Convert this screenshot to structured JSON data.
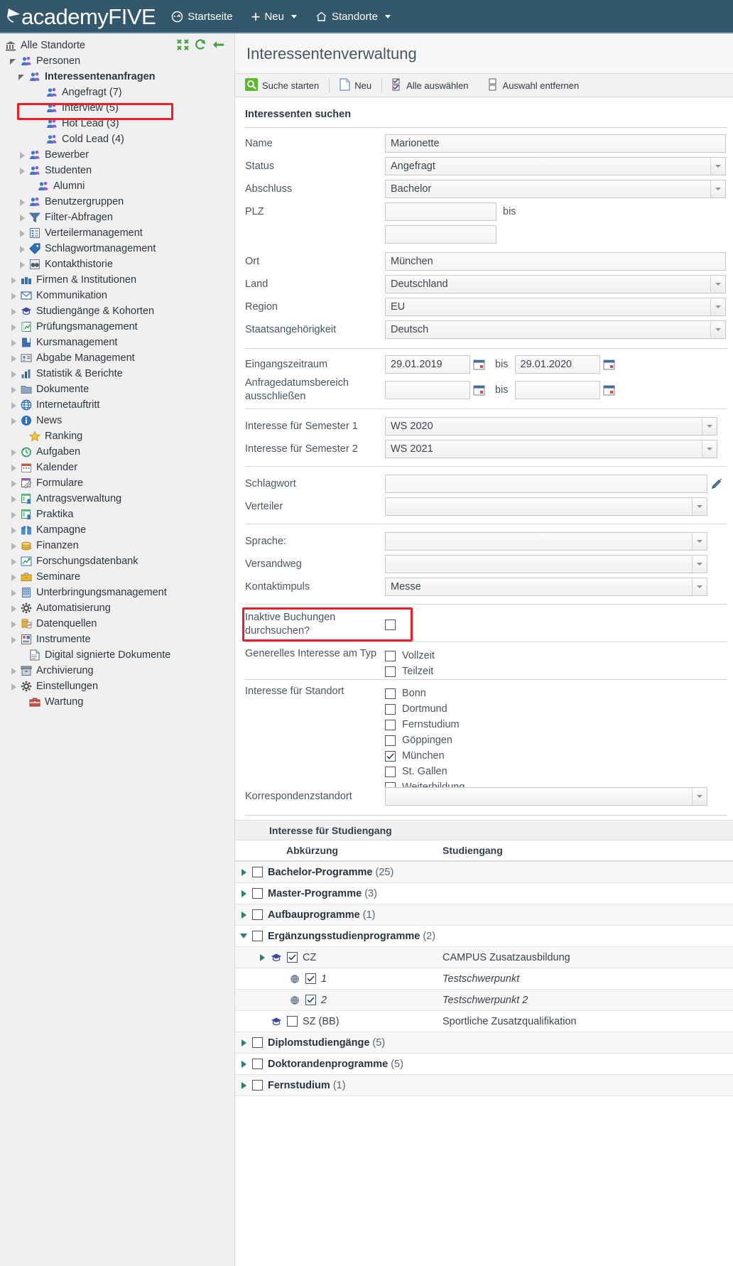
{
  "topbar": {
    "brand_a": "academy",
    "brand_b": "FIVE",
    "nav": [
      {
        "label": "Startseite",
        "icon": "dashboard-icon",
        "caret": false
      },
      {
        "label": "Neu",
        "icon": "plus-icon",
        "caret": true
      },
      {
        "label": "Standorte",
        "icon": "home-icon",
        "caret": true
      }
    ]
  },
  "sidebar": {
    "root": "Alle Standorte",
    "items": [
      {
        "label": "Personen",
        "indent": 1,
        "arrow": "open",
        "icon": "people-icon"
      },
      {
        "label": "Interessentenanfragen",
        "indent": 2,
        "arrow": "open",
        "icon": "people-icon",
        "bold": true,
        "highlight": true
      },
      {
        "label": "Angefragt (7)",
        "indent": 4,
        "arrow": "none",
        "icon": "people-icon"
      },
      {
        "label": "Interview (5)",
        "indent": 4,
        "arrow": "none",
        "icon": "people-icon"
      },
      {
        "label": "Hot Lead (3)",
        "indent": 4,
        "arrow": "none",
        "icon": "people-icon"
      },
      {
        "label": "Cold Lead (4)",
        "indent": 4,
        "arrow": "none",
        "icon": "people-icon"
      },
      {
        "label": "Bewerber",
        "indent": 2,
        "arrow": "closed",
        "icon": "people-icon"
      },
      {
        "label": "Studenten",
        "indent": 2,
        "arrow": "closed",
        "icon": "people-icon"
      },
      {
        "label": "Alumni",
        "indent": 3,
        "arrow": "none",
        "icon": "people-icon"
      },
      {
        "label": "Benutzergruppen",
        "indent": 2,
        "arrow": "closed",
        "icon": "people-icon"
      },
      {
        "label": "Filter-Abfragen",
        "indent": 2,
        "arrow": "closed",
        "icon": "filter-icon"
      },
      {
        "label": "Verteilermanagement",
        "indent": 2,
        "arrow": "closed",
        "icon": "list-icon"
      },
      {
        "label": "Schlagwortmanagement",
        "indent": 2,
        "arrow": "closed",
        "icon": "tag-icon"
      },
      {
        "label": "Kontakthistorie",
        "indent": 2,
        "arrow": "closed",
        "icon": "binoculars-icon"
      },
      {
        "label": "Firmen & Institutionen",
        "indent": 1,
        "arrow": "closed",
        "icon": "factory-icon"
      },
      {
        "label": "Kommunikation",
        "indent": 1,
        "arrow": "closed",
        "icon": "mail-icon"
      },
      {
        "label": "Studiengänge & Kohorten",
        "indent": 1,
        "arrow": "closed",
        "icon": "graduation-cap-icon"
      },
      {
        "label": "Prüfungsmanagement",
        "indent": 1,
        "arrow": "closed",
        "icon": "exam-icon"
      },
      {
        "label": "Kursmanagement",
        "indent": 1,
        "arrow": "closed",
        "icon": "book-icon"
      },
      {
        "label": "Abgabe Management",
        "indent": 1,
        "arrow": "closed",
        "icon": "card-icon"
      },
      {
        "label": "Statistik & Berichte",
        "indent": 1,
        "arrow": "closed",
        "icon": "bar-chart-icon"
      },
      {
        "label": "Dokumente",
        "indent": 1,
        "arrow": "closed",
        "icon": "folder-icon"
      },
      {
        "label": "Internetauftritt",
        "indent": 1,
        "arrow": "closed",
        "icon": "globe-icon"
      },
      {
        "label": "News",
        "indent": 1,
        "arrow": "closed",
        "icon": "info-icon"
      },
      {
        "label": "Ranking",
        "indent": 2,
        "arrow": "none",
        "icon": "star-icon"
      },
      {
        "label": "Aufgaben",
        "indent": 1,
        "arrow": "closed",
        "icon": "clock-icon"
      },
      {
        "label": "Kalender",
        "indent": 1,
        "arrow": "closed",
        "icon": "calendar-icon"
      },
      {
        "label": "Formulare",
        "indent": 1,
        "arrow": "closed",
        "icon": "form-icon"
      },
      {
        "label": "Antragsverwaltung",
        "indent": 1,
        "arrow": "closed",
        "icon": "application-icon"
      },
      {
        "label": "Praktika",
        "indent": 1,
        "arrow": "closed",
        "icon": "application-icon"
      },
      {
        "label": "Kampagne",
        "indent": 1,
        "arrow": "closed",
        "icon": "gift-icon"
      },
      {
        "label": "Finanzen",
        "indent": 1,
        "arrow": "closed",
        "icon": "coins-icon"
      },
      {
        "label": "Forschungsdatenbank",
        "indent": 1,
        "arrow": "closed",
        "icon": "research-icon"
      },
      {
        "label": "Seminare",
        "indent": 1,
        "arrow": "closed",
        "icon": "briefcase-icon"
      },
      {
        "label": "Unterbringungsmanagement",
        "indent": 1,
        "arrow": "closed",
        "icon": "building-icon"
      },
      {
        "label": "Automatisierung",
        "indent": 1,
        "arrow": "closed",
        "icon": "gear-icon"
      },
      {
        "label": "Datenquellen",
        "indent": 1,
        "arrow": "closed",
        "icon": "database-icon"
      },
      {
        "label": "Instrumente",
        "indent": 1,
        "arrow": "closed",
        "icon": "instruments-icon"
      },
      {
        "label": "Digital signierte Dokumente",
        "indent": 2,
        "arrow": "none",
        "icon": "document-icon"
      },
      {
        "label": "Archivierung",
        "indent": 1,
        "arrow": "closed",
        "icon": "archive-icon"
      },
      {
        "label": "Einstellungen",
        "indent": 1,
        "arrow": "closed",
        "icon": "gear-icon"
      },
      {
        "label": "Wartung",
        "indent": 2,
        "arrow": "none",
        "icon": "toolbox-icon"
      }
    ]
  },
  "page": {
    "title": "Interessentenverwaltung",
    "toolbar": [
      {
        "label": "Suche starten",
        "icon": "search-icon"
      },
      {
        "label": "Neu",
        "icon": "new-document-icon"
      },
      {
        "label": "Alle auswählen",
        "icon": "select-all-icon"
      },
      {
        "label": "Auswahl entfernen",
        "icon": "deselect-icon"
      }
    ],
    "section_title": "Interessenten suchen",
    "fields": {
      "name_label": "Name",
      "name_value": "Marionette",
      "status_label": "Status",
      "status_value": "Angefragt",
      "abschluss_label": "Abschluss",
      "abschluss_value": "Bachelor",
      "plz_label": "PLZ",
      "plz_from": "",
      "plz_to": "",
      "bis": "bis",
      "ort_label": "Ort",
      "ort_value": "München",
      "land_label": "Land",
      "land_value": "Deutschland",
      "region_label": "Region",
      "region_value": "EU",
      "staat_label": "Staatsangehörigkeit",
      "staat_value": "Deutsch",
      "eingang_label": "Eingangszeitraum",
      "eingang_from": "29.01.2019",
      "eingang_to": "29.01.2020",
      "anfrage_label": "Anfragedatumsbereich ausschließen",
      "anfrage_from": "",
      "anfrage_to": "",
      "sem1_label": "Interesse für Semester 1",
      "sem1_value": "WS 2020",
      "sem2_label": "Interesse für Semester 2",
      "sem2_value": "WS 2021",
      "schlagwort_label": "Schlagwort",
      "schlagwort_value": "",
      "verteiler_label": "Verteiler",
      "verteiler_value": "",
      "sprache_label": "Sprache:",
      "sprache_value": "",
      "versandweg_label": "Versandweg",
      "versandweg_value": "",
      "kontaktimpuls_label": "Kontaktimpuls",
      "kontaktimpuls_value": "Messe",
      "inaktive_label": "Inaktive Buchungen durchsuchen?",
      "inaktive_checked": false,
      "typ_label": "Generelles Interesse am Typ",
      "standort_label": "Interesse für Standort",
      "korrespondenz_label": "Korrespondenzstandort",
      "korrespondenz_value": ""
    },
    "typ_options": [
      {
        "label": "Vollzeit",
        "checked": false
      },
      {
        "label": "Teilzeit",
        "checked": false
      }
    ],
    "standort_options": [
      {
        "label": "Bonn",
        "checked": false
      },
      {
        "label": "Dortmund",
        "checked": false
      },
      {
        "label": "Fernstudium",
        "checked": false
      },
      {
        "label": "Göppingen",
        "checked": false
      },
      {
        "label": "München",
        "checked": true
      },
      {
        "label": "St. Gallen",
        "checked": false
      },
      {
        "label": "Weiterbildung",
        "checked": false
      }
    ],
    "table": {
      "caption": "Interesse für Studiengang",
      "col_abk": "Abkürzung",
      "col_sg": "Studiengang",
      "rows": [
        {
          "level": 0,
          "arrow": "closed",
          "checked": false,
          "bold": true,
          "abk": "Bachelor-Programme",
          "count": "(25)",
          "sg": "",
          "icon": ""
        },
        {
          "level": 0,
          "arrow": "closed",
          "checked": false,
          "bold": true,
          "abk": "Master-Programme",
          "count": "(3)",
          "sg": "",
          "icon": ""
        },
        {
          "level": 0,
          "arrow": "closed",
          "checked": false,
          "bold": true,
          "abk": "Aufbauprogramme",
          "count": "(1)",
          "sg": "",
          "icon": ""
        },
        {
          "level": 0,
          "arrow": "open",
          "checked": false,
          "bold": true,
          "abk": "Ergänzungsstudienprogramme",
          "count": "(2)",
          "sg": "",
          "icon": ""
        },
        {
          "level": 1,
          "arrow": "closed",
          "checked": true,
          "bold": false,
          "abk": "CZ",
          "count": "",
          "sg": "CAMPUS Zusatzausbildung",
          "icon": "graduation-cap-icon"
        },
        {
          "level": 2,
          "arrow": "none",
          "checked": true,
          "bold": false,
          "abk": "1",
          "count": "",
          "sg": "Testschwerpunkt",
          "icon": "focus-icon",
          "italic": true
        },
        {
          "level": 2,
          "arrow": "none",
          "checked": true,
          "bold": false,
          "abk": "2",
          "count": "",
          "sg": "Testschwerpunkt 2",
          "icon": "focus-icon",
          "italic": true
        },
        {
          "level": 1,
          "arrow": "none",
          "checked": false,
          "bold": false,
          "abk": "SZ (BB)",
          "count": "",
          "sg": "Sportliche Zusatzqualifikation",
          "icon": "graduation-cap-icon"
        },
        {
          "level": 0,
          "arrow": "closed",
          "checked": false,
          "bold": true,
          "abk": "Diplomstudiengänge",
          "count": "(5)",
          "sg": "",
          "icon": ""
        },
        {
          "level": 0,
          "arrow": "closed",
          "checked": false,
          "bold": true,
          "abk": "Doktorandenprogramme",
          "count": "(5)",
          "sg": "",
          "icon": ""
        },
        {
          "level": 0,
          "arrow": "closed",
          "checked": false,
          "bold": true,
          "abk": "Fernstudium",
          "count": "(1)",
          "sg": "",
          "icon": ""
        }
      ]
    }
  },
  "colors": {
    "topbar": "#34586b",
    "highlight": "#ee1c24",
    "tree_arrow": "#2e7d6e"
  }
}
